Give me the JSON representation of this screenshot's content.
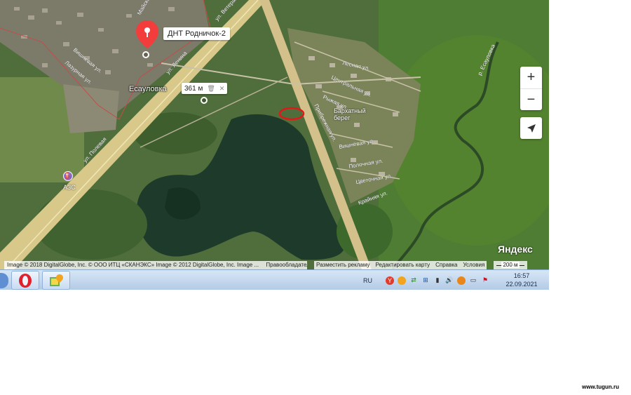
{
  "map": {
    "place_name": "Есауловка",
    "pin_label": "ДНТ Родничок-2",
    "measure": {
      "distance": "361 м",
      "delete_icon": "trash-icon",
      "close_icon": "close-icon"
    },
    "labels": {
      "azs": "АЗС",
      "barkhatny": "Бархатный\nберег",
      "river": "р. Есауловка",
      "streets": [
        "Лесная ул.",
        "Центральная ул.",
        "Рыжая ул.",
        "Прибрежная ул.",
        "Вишнёвая ул.",
        "Полочная ул.",
        "Цветочная ул.",
        "Крайняя ул.",
        "ул. Ветеранов",
        "Вишнёвая ул.",
        "Лазурная ул.",
        "ул. Полевая",
        "ул. Ленина",
        "Майская ул."
      ]
    },
    "controls": {
      "zoom_in": "+",
      "zoom_out": "−",
      "locate_icon": "arrow-locate-icon"
    },
    "logo": "Яндекс",
    "copyright": "Image © 2018 DigitalGlobe, Inc. © ООО ИТЦ «СКАНЭКС» Image © 2012 DigitalGlobe, Inc. Image ...",
    "rights_link": "Правообладатели",
    "links": [
      "Разместить рекламу",
      "Редактировать карту",
      "Справка",
      "Условия"
    ],
    "scale": "200 м"
  },
  "taskbar": {
    "apps": [
      {
        "name": "opera-icon"
      },
      {
        "name": "maps-app-icon"
      }
    ],
    "lang": "RU",
    "tray_icons": [
      "yandex-icon",
      "chrome-icon",
      "network-icon",
      "windows-icon",
      "battery-icon",
      "volume-icon",
      "antivirus-icon",
      "display-icon",
      "flag-icon"
    ],
    "time": "16:57",
    "date": "22.09.2021"
  },
  "watermark": "www.tugun.ru"
}
